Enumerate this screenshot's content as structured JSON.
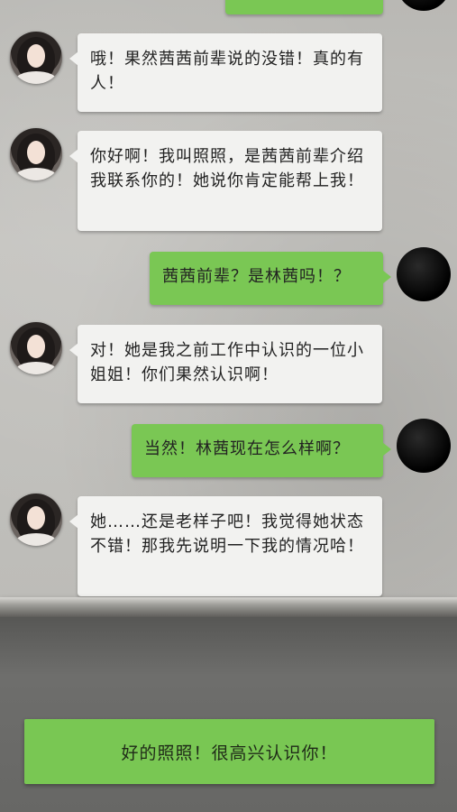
{
  "chat": {
    "messages": [
      {
        "side": "right",
        "text": ""
      },
      {
        "side": "left",
        "text": "哦！果然茜茜前辈说的没错！真的有人！"
      },
      {
        "side": "left",
        "text": "你好啊！我叫照照，是茜茜前辈介绍我联系你的！她说你肯定能帮上我！"
      },
      {
        "side": "right",
        "text": "茜茜前辈？是林茜吗！？"
      },
      {
        "side": "left",
        "text": "对！她是我之前工作中认识的一位小姐姐！你们果然认识啊！"
      },
      {
        "side": "right",
        "text": "当然！林茜现在怎么样啊？"
      },
      {
        "side": "left",
        "text": "她……还是老样子吧！我觉得她状态不错！那我先说明一下我的情况哈！"
      }
    ]
  },
  "reply": {
    "option_label": "好的照照！很高兴认识你！"
  },
  "colors": {
    "bubble_self": "#7ac754",
    "bubble_other": "#f2f2f0"
  }
}
